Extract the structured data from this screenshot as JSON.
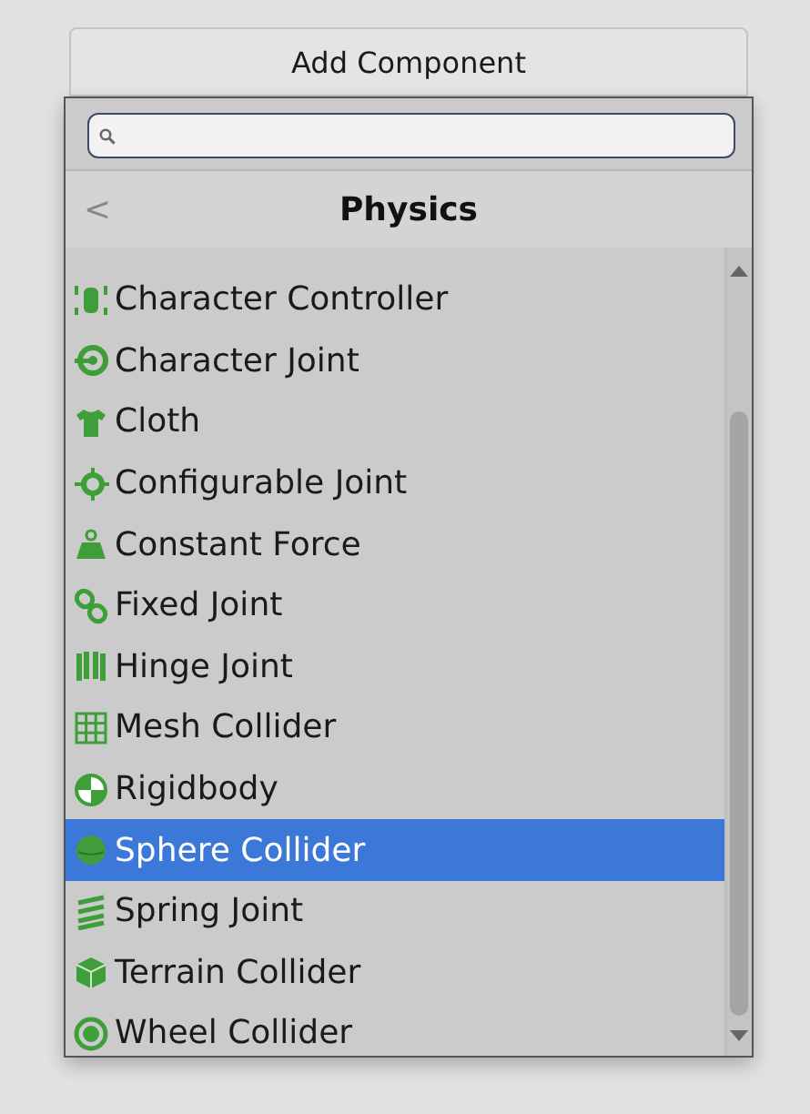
{
  "add_component_button": {
    "label": "Add Component"
  },
  "header": {
    "back": "<",
    "title": "Physics"
  },
  "items": [
    {
      "label": "Character Controller",
      "selected": false
    },
    {
      "label": "Character Joint",
      "selected": false
    },
    {
      "label": "Cloth",
      "selected": false
    },
    {
      "label": "Configurable Joint",
      "selected": false
    },
    {
      "label": "Constant Force",
      "selected": false
    },
    {
      "label": "Fixed Joint",
      "selected": false
    },
    {
      "label": "Hinge Joint",
      "selected": false
    },
    {
      "label": "Mesh Collider",
      "selected": false
    },
    {
      "label": "Rigidbody",
      "selected": false
    },
    {
      "label": "Sphere Collider",
      "selected": true
    },
    {
      "label": "Spring Joint",
      "selected": false
    },
    {
      "label": "Terrain Collider",
      "selected": false
    },
    {
      "label": "Wheel Collider",
      "selected": false
    }
  ]
}
